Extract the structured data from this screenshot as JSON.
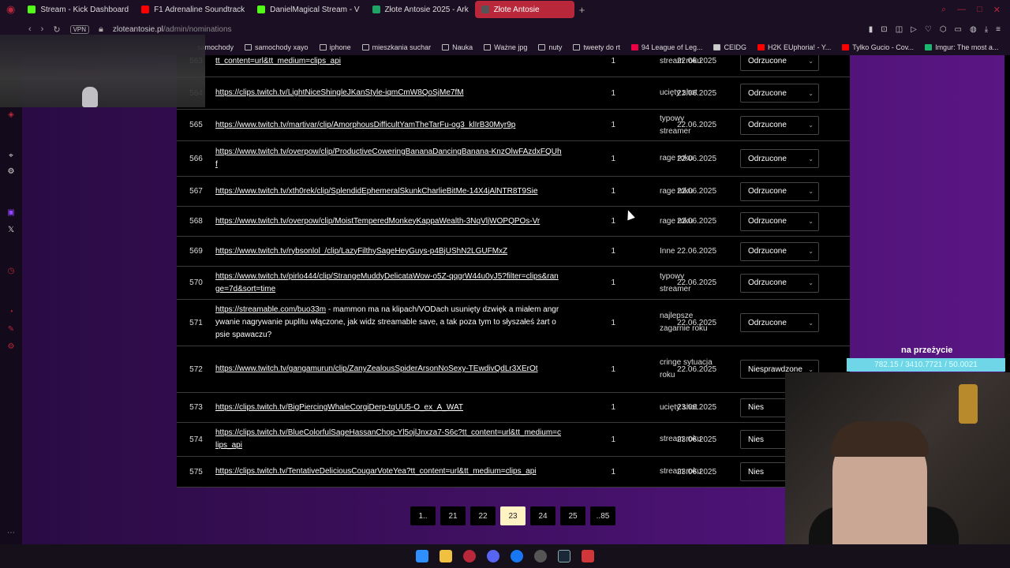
{
  "tabs": [
    {
      "label": "Stream - Kick Dashboard",
      "color": "#53fc18"
    },
    {
      "label": "F1 Adrenaline Soundtrack",
      "color": "#ff0000"
    },
    {
      "label": "DanielMagical Stream - V",
      "color": "#53fc18"
    },
    {
      "label": "Złote Antosie 2025 - Ark",
      "color": "#1fa463"
    },
    {
      "label": "Złote Antosie",
      "color": "#555555",
      "active": true
    }
  ],
  "address": {
    "vpn": "VPN",
    "domain": "zloteantosie.pl",
    "path": "/admin/nominations"
  },
  "bookmarks": [
    "samochody",
    "samochody xayo",
    "iphone",
    "mieszkania suchar",
    "Nauka",
    "Ważne jpg",
    "nuty",
    "tweety do rt",
    "94 League of Leg...",
    "CEIDG",
    "H2K EUphoria! - Y...",
    "Tylko Gucio - Cov...",
    "Imgur: The most a..."
  ],
  "rows": [
    {
      "id": "563",
      "link": "tt_content=url&tt_medium=clips_api",
      "count": "1",
      "cat": "stream roku",
      "date": "22.06.2025",
      "status": "Odrzucone"
    },
    {
      "id": "564",
      "link": "https://clips.twitch.tv/LightNiceShingleJKanStyle-iqmCmW8QoSjMe7fM",
      "count": "1",
      "cat": "ucięty shot",
      "date": "22.06.2025",
      "status": "Odrzucone"
    },
    {
      "id": "565",
      "link": "https://www.twitch.tv/martivar/clip/AmorphousDifficultYamTheTarFu-og3_klIrB30Myr9p",
      "count": "1",
      "cat": "typowy streamer",
      "date": "22.06.2025",
      "status": "Odrzucone"
    },
    {
      "id": "566",
      "link": "https://www.twitch.tv/overpow/clip/ProductiveCoweringBananaDancingBanana-KnzOlwFAzdxFQUhf",
      "count": "1",
      "cat": "rage roku",
      "date": "22.06.2025",
      "status": "Odrzucone"
    },
    {
      "id": "567",
      "link": "https://www.twitch.tv/xth0rek/clip/SplendidEphemeralSkunkCharlieBitMe-14X4jAlNTR8T9Sie",
      "count": "1",
      "cat": "rage roku",
      "date": "22.06.2025",
      "status": "Odrzucone"
    },
    {
      "id": "568",
      "link": "https://www.twitch.tv/overpow/clip/MoistTemperedMonkeyKappaWealth-3NqVljWOPQPOs-Vr",
      "count": "1",
      "cat": "rage roku",
      "date": "22.06.2025",
      "status": "Odrzucone"
    },
    {
      "id": "569",
      "link": "https://www.twitch.tv/rybsonlol_/clip/LazyFilthySageHeyGuys-p4BjUShN2LGUFMxZ",
      "count": "1",
      "cat": "Inne",
      "date": "22.06.2025",
      "status": "Odrzucone"
    },
    {
      "id": "570",
      "link": "https://www.twitch.tv/pirlo444/clip/StrangeMuddyDelicataWow-o5Z-qqgrW44u0yJ5?filter=clips&range=7d&sort=time",
      "count": "1",
      "cat": "typowy streamer",
      "date": "22.06.2025",
      "status": "Odrzucone"
    },
    {
      "id": "571",
      "link": "https://streamable.com/buo33m",
      "note": " - mammon ma na klipach/VODach usunięty dzwięk a miałem angrywanie nagrywanie puplitu włączone, jak widz streamable save, a tak poza tym to słyszałeś żart o psie spawaczu?",
      "count": "1",
      "cat": "najlepsze zagarnie roku",
      "date": "22.06.2025",
      "status": "Odrzucone"
    },
    {
      "id": "572",
      "link": "https://www.twitch.tv/gangamurun/clip/ZanyZealousSpiderArsonNoSexy-TEwdivQdLr3XErOt",
      "count": "1",
      "cat": "cringe sytuacja roku",
      "date": "22.06.2025",
      "status": "Niesprawdzone"
    },
    {
      "id": "573",
      "link": "https://clips.twitch.tv/BigPiercingWhaleCorgiDerp-tqUU5-O_ex_A_WAT",
      "count": "1",
      "cat": "ucięty shot",
      "date": "23.06.2025",
      "status": "Nies"
    },
    {
      "id": "574",
      "link": "https://clips.twitch.tv/BlueColorfulSageHassanChop-Yl5ojlJnxza7-S6c?tt_content=url&tt_medium=clips_api",
      "count": "1",
      "cat": "stream roku",
      "date": "23.06.2025",
      "status": "Nies"
    },
    {
      "id": "575",
      "link": "https://clips.twitch.tv/TentativeDeliciousCougarVoteYea?tt_content=url&tt_medium=clips_api",
      "count": "1",
      "cat": "stream roku",
      "date": "23.06.2025",
      "status": "Nies"
    }
  ],
  "pagination": [
    "1..",
    "21",
    "22",
    "23",
    "24",
    "25",
    "..85"
  ],
  "overlay": {
    "label": "na przeżycie",
    "bar": "782.15 / 3410.7721 / 50.0021"
  }
}
